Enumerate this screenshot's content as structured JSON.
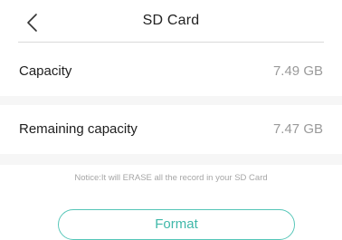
{
  "header": {
    "title": "SD Card",
    "back_icon": "chevron-left-icon"
  },
  "rows": [
    {
      "label": "Capacity",
      "value": "7.49 GB"
    },
    {
      "label": "Remaining capacity",
      "value": "7.47 GB"
    }
  ],
  "notice": "Notice:It will ERASE all the record in your SD Card",
  "format_button": {
    "label": "Format"
  },
  "colors": {
    "accent": "#55c6b8",
    "value_text": "#9a9a9a",
    "divider": "#dadada"
  }
}
